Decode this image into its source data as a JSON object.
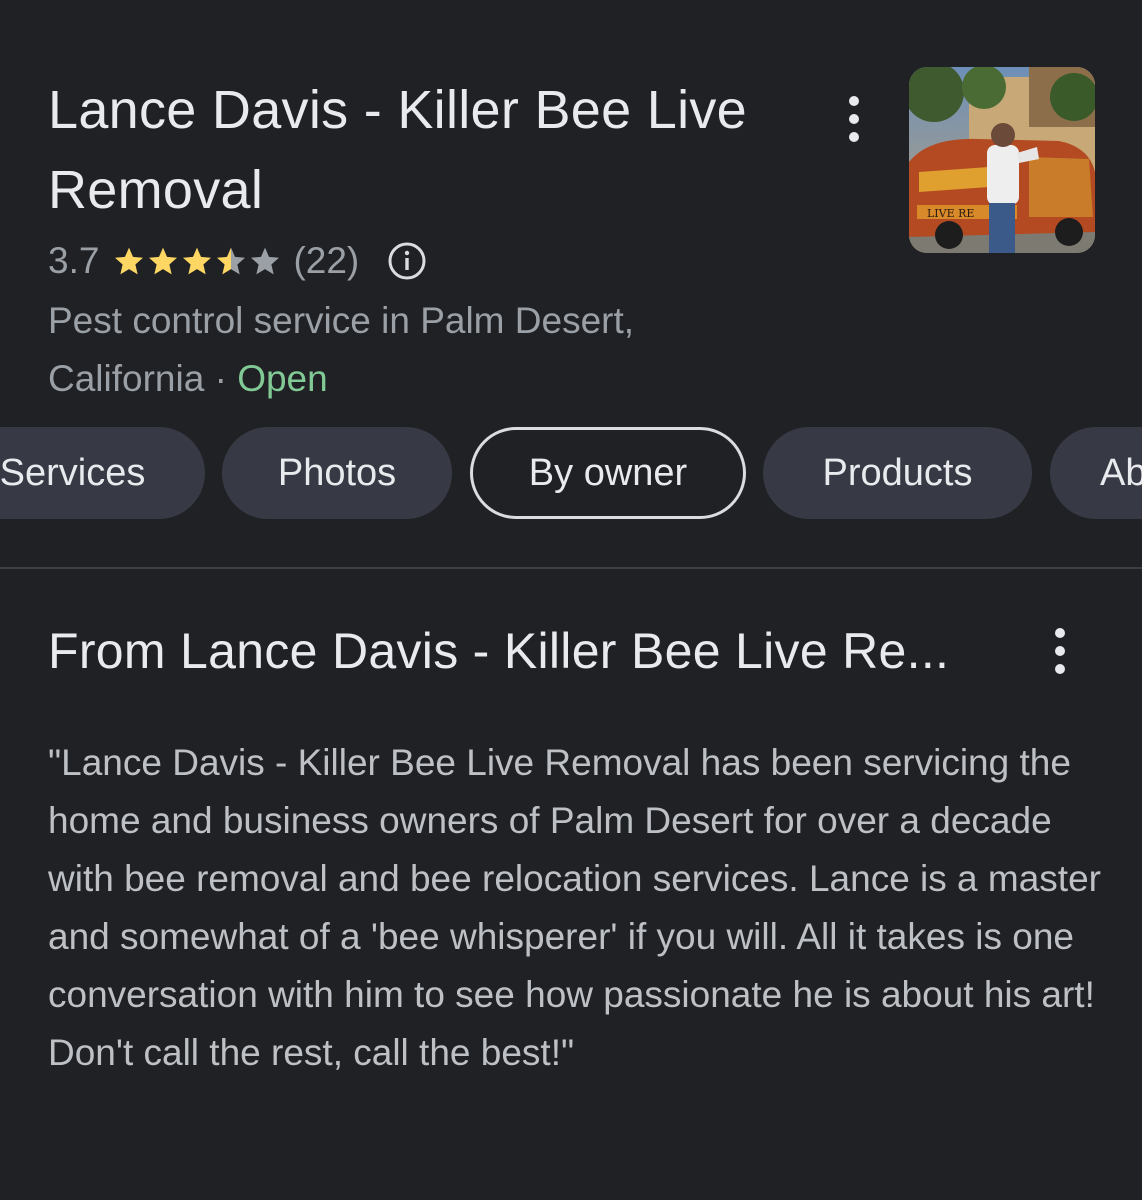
{
  "header": {
    "title": "Lance Davis - Killer Bee Live Removal",
    "rating": "3.7",
    "rating_value": 3.7,
    "rating_max": 5,
    "review_count": "(22)",
    "category_text": "Pest control service in Palm Desert, California",
    "separator": "·",
    "status": "Open",
    "thumbnail_banner_text": "LIVE RE"
  },
  "chips": [
    {
      "label": "Services"
    },
    {
      "label": "Photos"
    },
    {
      "label": "By owner",
      "selected": true
    },
    {
      "label": "Products"
    },
    {
      "label": "Ab"
    }
  ],
  "section": {
    "title": "From Lance Davis - Killer Bee Live Re...",
    "description": "\"Lance Davis - Killer Bee Live Removal has been servicing the home and business owners of Palm Desert for over a decade with bee removal and bee relocation services. Lance is a master and somewhat of a 'bee whisperer' if you will. All it takes is one conversation with him to see how passionate he is about his art! Don't call the rest, call the best!\""
  },
  "colors": {
    "background": "#202124",
    "text_primary": "#e8eaed",
    "text_secondary": "#9aa0a6",
    "star": "#fdd663",
    "star_empty": "#9aa0a6",
    "open_status": "#81c995",
    "chip_bg": "#373a45"
  },
  "icons": {
    "menu": "more-vert-icon",
    "info": "info-icon",
    "star": "star-icon"
  }
}
